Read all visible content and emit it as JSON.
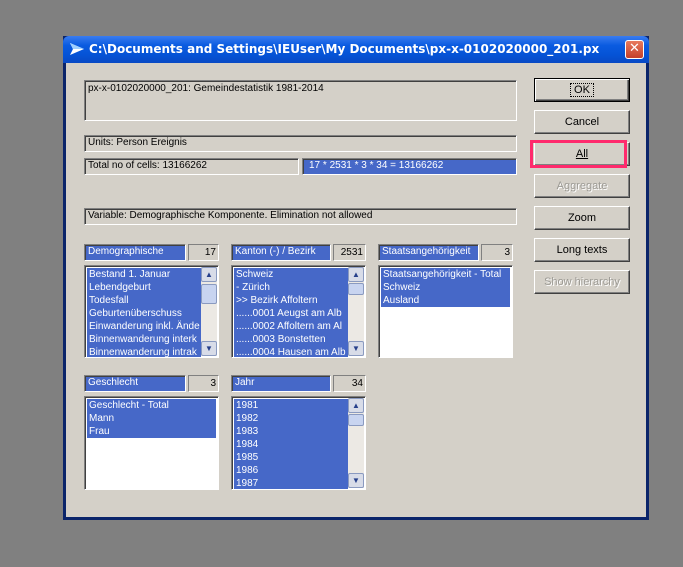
{
  "window": {
    "title": "C:\\Documents and Settings\\IEUser\\My Documents\\px-x-0102020000_201.px",
    "close_glyph": "✕"
  },
  "info": {
    "description": "px-x-0102020000_201: Gemeindestatistik 1981-2014",
    "units": "Units: Person Ereignis",
    "total_cells": "Total no of cells:  13166262",
    "formula": "17 *  2531 *  3 *  34  =  13166262",
    "variable_note": "Variable: Demographische Komponente. Elimination not allowed"
  },
  "buttons": {
    "ok": "OK",
    "cancel": "Cancel",
    "all": "All",
    "aggregate": "Aggregate",
    "zoom": "Zoom",
    "long_texts": "Long texts",
    "show_hierarchy": "Show hierarchy"
  },
  "variables": [
    {
      "name": "Demographische",
      "count": "17",
      "items": [
        "Bestand 1. Januar",
        "Lebendgeburt",
        "Todesfall",
        "Geburtenüberschuss",
        "Einwanderung inkl. Ände",
        "Binnenwanderung interk",
        "Binnenwanderung intrak"
      ]
    },
    {
      "name": "Kanton (-) / Bezirk",
      "count": "2531",
      "items": [
        "Schweiz",
        "- Zürich",
        ">> Bezirk Affoltern",
        "......0001 Aeugst am Alb",
        "......0002 Affoltern am Al",
        "......0003 Bonstetten",
        "......0004 Hausen am Alb"
      ]
    },
    {
      "name": "Staatsangehörigkeit",
      "count": "3",
      "items": [
        "Staatsangehörigkeit - Total",
        "Schweiz",
        "Ausland"
      ]
    },
    {
      "name": "Geschlecht",
      "count": "3",
      "items": [
        "Geschlecht - Total",
        "Mann",
        "Frau"
      ]
    },
    {
      "name": "Jahr",
      "count": "34",
      "items": [
        "1981",
        "1982",
        "1983",
        "1984",
        "1985",
        "1986",
        "1987"
      ]
    }
  ],
  "colors": {
    "selection": "#4668c8",
    "highlight": "#ff2a6d",
    "dialog_bg": "#d4d0c8"
  }
}
